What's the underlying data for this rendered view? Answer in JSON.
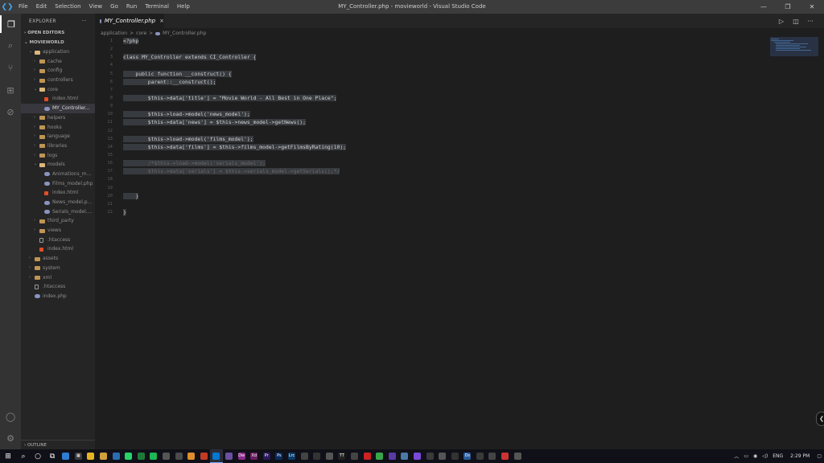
{
  "app": {
    "window_title": "MY_Controller.php - movieworld - Visual Studio Code",
    "menu": [
      "File",
      "Edit",
      "Selection",
      "View",
      "Go",
      "Run",
      "Terminal",
      "Help"
    ]
  },
  "sidebar": {
    "header": "EXPLORER",
    "more": "···",
    "open_editors": "OPEN EDITORS",
    "project": "MOVIEWORLD",
    "outline": "OUTLINE",
    "tree": [
      {
        "label": "application",
        "depth": 1,
        "type": "folder-open",
        "chev": "⌄"
      },
      {
        "label": "cache",
        "depth": 2,
        "type": "folder",
        "chev": "›"
      },
      {
        "label": "config",
        "depth": 2,
        "type": "folder",
        "chev": "›"
      },
      {
        "label": "controllers",
        "depth": 2,
        "type": "folder",
        "chev": "›"
      },
      {
        "label": "core",
        "depth": 2,
        "type": "folder-open",
        "chev": "⌄"
      },
      {
        "label": "index.html",
        "depth": 3,
        "type": "html",
        "chev": ""
      },
      {
        "label": "MY_Controller...",
        "depth": 3,
        "type": "php",
        "chev": "",
        "selected": true
      },
      {
        "label": "helpers",
        "depth": 2,
        "type": "folder",
        "chev": "›"
      },
      {
        "label": "hooks",
        "depth": 2,
        "type": "folder",
        "chev": "›"
      },
      {
        "label": "language",
        "depth": 2,
        "type": "folder",
        "chev": "›"
      },
      {
        "label": "libraries",
        "depth": 2,
        "type": "folder",
        "chev": "›"
      },
      {
        "label": "logs",
        "depth": 2,
        "type": "folder",
        "chev": "›"
      },
      {
        "label": "models",
        "depth": 2,
        "type": "folder-open",
        "chev": "⌄"
      },
      {
        "label": "Animations_m...",
        "depth": 3,
        "type": "php",
        "chev": ""
      },
      {
        "label": "Films_model.php",
        "depth": 3,
        "type": "php",
        "chev": ""
      },
      {
        "label": "index.html",
        "depth": 3,
        "type": "html",
        "chev": ""
      },
      {
        "label": "News_model.p...",
        "depth": 3,
        "type": "php",
        "chev": ""
      },
      {
        "label": "Serials_model....",
        "depth": 3,
        "type": "php",
        "chev": ""
      },
      {
        "label": "third_party",
        "depth": 2,
        "type": "folder",
        "chev": "›"
      },
      {
        "label": "views",
        "depth": 2,
        "type": "folder",
        "chev": "›"
      },
      {
        "label": ".htaccess",
        "depth": 2,
        "type": "file",
        "chev": ""
      },
      {
        "label": "index.html",
        "depth": 2,
        "type": "html",
        "chev": ""
      },
      {
        "label": "assets",
        "depth": 1,
        "type": "folder",
        "chev": "›"
      },
      {
        "label": "system",
        "depth": 1,
        "type": "folder",
        "chev": "›"
      },
      {
        "label": "xml",
        "depth": 1,
        "type": "folder",
        "chev": "›"
      },
      {
        "label": ".htaccess",
        "depth": 1,
        "type": "file",
        "chev": ""
      },
      {
        "label": "index.php",
        "depth": 1,
        "type": "php",
        "chev": ""
      }
    ]
  },
  "tab": {
    "label": "MY_Controller.php",
    "close": "×"
  },
  "breadcrumb": [
    "application",
    ">",
    "core",
    ">",
    "MY_Controller.php"
  ],
  "editor": {
    "line_numbers": [
      "1",
      "2",
      "3",
      "4",
      "5",
      "6",
      "7",
      "8",
      "9",
      "10",
      "11",
      "12",
      "13",
      "14",
      "15",
      "16",
      "17",
      "18",
      "19",
      "20",
      "21",
      "22"
    ],
    "lines": [
      {
        "text": "<?php",
        "kind": "code"
      },
      {
        "text": "",
        "kind": "code"
      },
      {
        "text": "class MY_Controller extends CI_Controller {",
        "kind": "code"
      },
      {
        "text": "",
        "kind": "code"
      },
      {
        "text": "    public function __construct() {",
        "kind": "code"
      },
      {
        "text": "        parent::__construct();",
        "kind": "code"
      },
      {
        "text": "",
        "kind": "code"
      },
      {
        "text": "        $this->data['title'] = \"Movie World - All Best in One Place\";",
        "kind": "code"
      },
      {
        "text": "",
        "kind": "code"
      },
      {
        "text": "        $this->load->model('news_model');",
        "kind": "code"
      },
      {
        "text": "        $this->data['news'] = $this->news_model->getNews();",
        "kind": "code"
      },
      {
        "text": "",
        "kind": "code"
      },
      {
        "text": "        $this->load->model('films_model');",
        "kind": "code"
      },
      {
        "text": "        $this->data['films'] = $this->films_model->getFilmsByRating(10);",
        "kind": "code"
      },
      {
        "text": "",
        "kind": "code"
      },
      {
        "text": "        /*$this->load->model('serials_model');",
        "kind": "comment"
      },
      {
        "text": "        $this->data['serials'] = $this->serials_model->getSerials();*/",
        "kind": "comment"
      },
      {
        "text": "",
        "kind": "code"
      },
      {
        "text": "",
        "kind": "code"
      },
      {
        "text": "    }",
        "kind": "code"
      },
      {
        "text": "",
        "kind": "code"
      },
      {
        "text": "}",
        "kind": "code"
      }
    ]
  },
  "taskbar": {
    "clock": "2:29 PM",
    "apps": [
      {
        "color": "#2d7dd2",
        "glyph": ""
      },
      {
        "color": "#3a3a3a",
        "glyph": "▦"
      },
      {
        "color": "#e6b422",
        "glyph": ""
      },
      {
        "color": "#cfa03a",
        "glyph": ""
      },
      {
        "color": "#2b6cb0",
        "glyph": ""
      },
      {
        "color": "#25d366",
        "glyph": ""
      },
      {
        "color": "#1f7a3a",
        "glyph": ""
      },
      {
        "color": "#1db954",
        "glyph": ""
      },
      {
        "color": "#555555",
        "glyph": ""
      },
      {
        "color": "#4a4a4a",
        "glyph": ""
      },
      {
        "color": "#e08e2b",
        "glyph": ""
      },
      {
        "color": "#c23b22",
        "glyph": ""
      },
      {
        "color": "#0078d4",
        "glyph": "",
        "active": true
      },
      {
        "color": "#6b4fa0",
        "glyph": ""
      },
      {
        "color": "#8b2a8b",
        "glyph": "Dw"
      },
      {
        "color": "#6c1d5f",
        "glyph": "Xd"
      },
      {
        "color": "#2a1a5e",
        "glyph": "Pr"
      },
      {
        "color": "#0a2a5e",
        "glyph": "Ps"
      },
      {
        "color": "#0d3b66",
        "glyph": "Lrc"
      },
      {
        "color": "#444444",
        "glyph": ""
      },
      {
        "color": "#333333",
        "glyph": ""
      },
      {
        "color": "#555555",
        "glyph": ""
      },
      {
        "color": "#222222",
        "glyph": "TT"
      },
      {
        "color": "#444444",
        "glyph": ""
      },
      {
        "color": "#cc2222",
        "glyph": ""
      },
      {
        "color": "#3aa64a",
        "glyph": ""
      },
      {
        "color": "#5a3aa6",
        "glyph": ""
      },
      {
        "color": "#4a7aa6",
        "glyph": ""
      },
      {
        "color": "#7a4ad6",
        "glyph": ""
      },
      {
        "color": "#3a3a3a",
        "glyph": ""
      },
      {
        "color": "#555555",
        "glyph": ""
      },
      {
        "color": "#333333",
        "glyph": ""
      },
      {
        "color": "#2a5a9a",
        "glyph": "Ds"
      },
      {
        "color": "#3a3a3a",
        "glyph": ""
      },
      {
        "color": "#444444",
        "glyph": ""
      },
      {
        "color": "#cc3333",
        "glyph": ""
      },
      {
        "color": "#555555",
        "glyph": ""
      }
    ]
  }
}
